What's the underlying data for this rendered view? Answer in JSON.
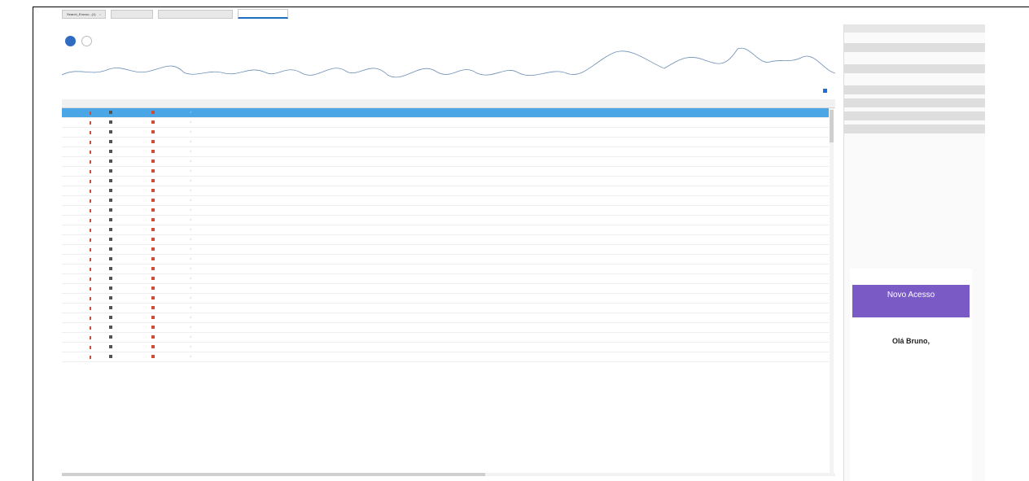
{
  "tabs": [
    {
      "label": "Search_Emvoo...(1)",
      "active": false
    },
    {
      "label": "(blurred)",
      "active": false
    },
    {
      "label": "(blurred)",
      "active": false
    },
    {
      "label": "(blurred)",
      "active": true
    }
  ],
  "preview": {
    "banner": "Novo Acesso",
    "greeting": "Olá Bruno,"
  },
  "colors": {
    "selected_row": "#4aa6e4",
    "accent": "#2f6bc1",
    "flag_red": "#d14b3b",
    "banner_purple": "#7a5bc6"
  },
  "row_count": 26,
  "selected_row_index": 0
}
